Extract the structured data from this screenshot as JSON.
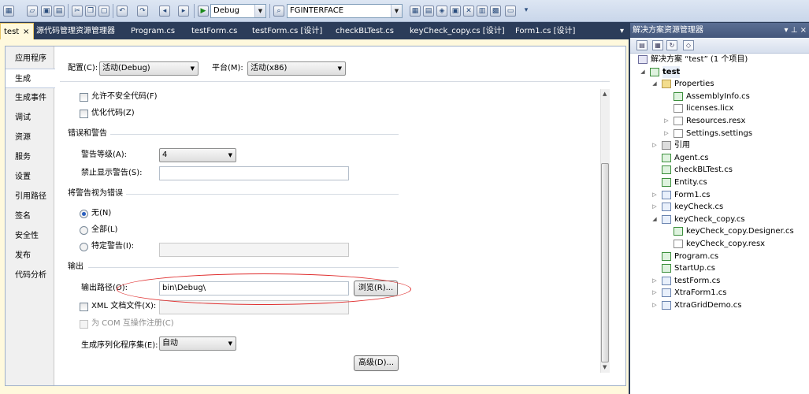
{
  "toolbar": {
    "config_combo": "Debug",
    "find_combo": "FGINTERFACE"
  },
  "tabs": [
    {
      "label": "test",
      "active": true
    },
    {
      "label": "源代码管理资源管理器"
    },
    {
      "label": "Program.cs"
    },
    {
      "label": "testForm.cs"
    },
    {
      "label": "testForm.cs [设计]"
    },
    {
      "label": "checkBLTest.cs"
    },
    {
      "label": "keyCheck_copy.cs [设计]"
    },
    {
      "label": "Form1.cs [设计]"
    }
  ],
  "tab_close": "×",
  "tab_dropdown": "▾",
  "nav": {
    "items": [
      "应用程序",
      "生成",
      "生成事件",
      "调试",
      "资源",
      "服务",
      "设置",
      "引用路径",
      "签名",
      "安全性",
      "发布",
      "代码分析"
    ],
    "selected": "生成"
  },
  "build": {
    "config_label": "配置(C):",
    "config_value": "活动(Debug)",
    "platform_label": "平台(M):",
    "platform_value": "活动(x86)",
    "allow_unsafe": "允许不安全代码(F)",
    "optimize": "优化代码(Z)",
    "errors_section": "错误和警告",
    "warning_level_label": "警告等级(A):",
    "warning_level_value": "4",
    "suppress_label": "禁止显示警告(S):",
    "suppress_value": "",
    "treat_section": "将警告视为错误",
    "none_label": "无(N)",
    "all_label": "全部(L)",
    "specific_label": "特定警告(I):",
    "specific_value": "",
    "output_section": "输出",
    "output_path_label": "输出路径(O):",
    "output_path_value": "bin\\Debug\\",
    "browse_button": "浏览(R)...",
    "xml_doc_label": "XML 文档文件(X):",
    "xml_doc_value": "",
    "com_label": "为 COM 互操作注册(C)",
    "serialization_label": "生成序列化程序集(E):",
    "serialization_value": "自动",
    "advanced_button": "高级(D)..."
  },
  "solution": {
    "title": "解决方案资源管理器",
    "pin": "▾ ⊥ ×",
    "tree": [
      {
        "label": "解决方案 “test” (1 个项目)",
        "indent": 0,
        "icon": "sln",
        "tw": ""
      },
      {
        "label": "test",
        "indent": 1,
        "icon": "cs",
        "tw": "◢",
        "bold": true,
        "hl": true
      },
      {
        "label": "Properties",
        "indent": 2,
        "icon": "folder",
        "tw": "◢"
      },
      {
        "label": "AssemblyInfo.cs",
        "indent": 3,
        "icon": "cs",
        "tw": ""
      },
      {
        "label": "licenses.licx",
        "indent": 3,
        "icon": "file",
        "tw": ""
      },
      {
        "label": "Resources.resx",
        "indent": 3,
        "icon": "file",
        "tw": "▷"
      },
      {
        "label": "Settings.settings",
        "indent": 3,
        "icon": "file",
        "tw": "▷"
      },
      {
        "label": "引用",
        "indent": 2,
        "icon": "ref",
        "tw": "▷"
      },
      {
        "label": "Agent.cs",
        "indent": 2,
        "icon": "cs",
        "tw": ""
      },
      {
        "label": "checkBLTest.cs",
        "indent": 2,
        "icon": "cs",
        "tw": ""
      },
      {
        "label": "Entity.cs",
        "indent": 2,
        "icon": "cs",
        "tw": ""
      },
      {
        "label": "Form1.cs",
        "indent": 2,
        "icon": "form",
        "tw": "▷"
      },
      {
        "label": "keyCheck.cs",
        "indent": 2,
        "icon": "form",
        "tw": "▷"
      },
      {
        "label": "keyCheck_copy.cs",
        "indent": 2,
        "icon": "form",
        "tw": "◢"
      },
      {
        "label": "keyCheck_copy.Designer.cs",
        "indent": 3,
        "icon": "cs",
        "tw": ""
      },
      {
        "label": "keyCheck_copy.resx",
        "indent": 3,
        "icon": "file",
        "tw": ""
      },
      {
        "label": "Program.cs",
        "indent": 2,
        "icon": "cs",
        "tw": ""
      },
      {
        "label": "StartUp.cs",
        "indent": 2,
        "icon": "cs",
        "tw": ""
      },
      {
        "label": "testForm.cs",
        "indent": 2,
        "icon": "form",
        "tw": "▷"
      },
      {
        "label": "XtraForm1.cs",
        "indent": 2,
        "icon": "form",
        "tw": "▷"
      },
      {
        "label": "XtraGridDemo.cs",
        "indent": 2,
        "icon": "form",
        "tw": "▷"
      }
    ]
  }
}
